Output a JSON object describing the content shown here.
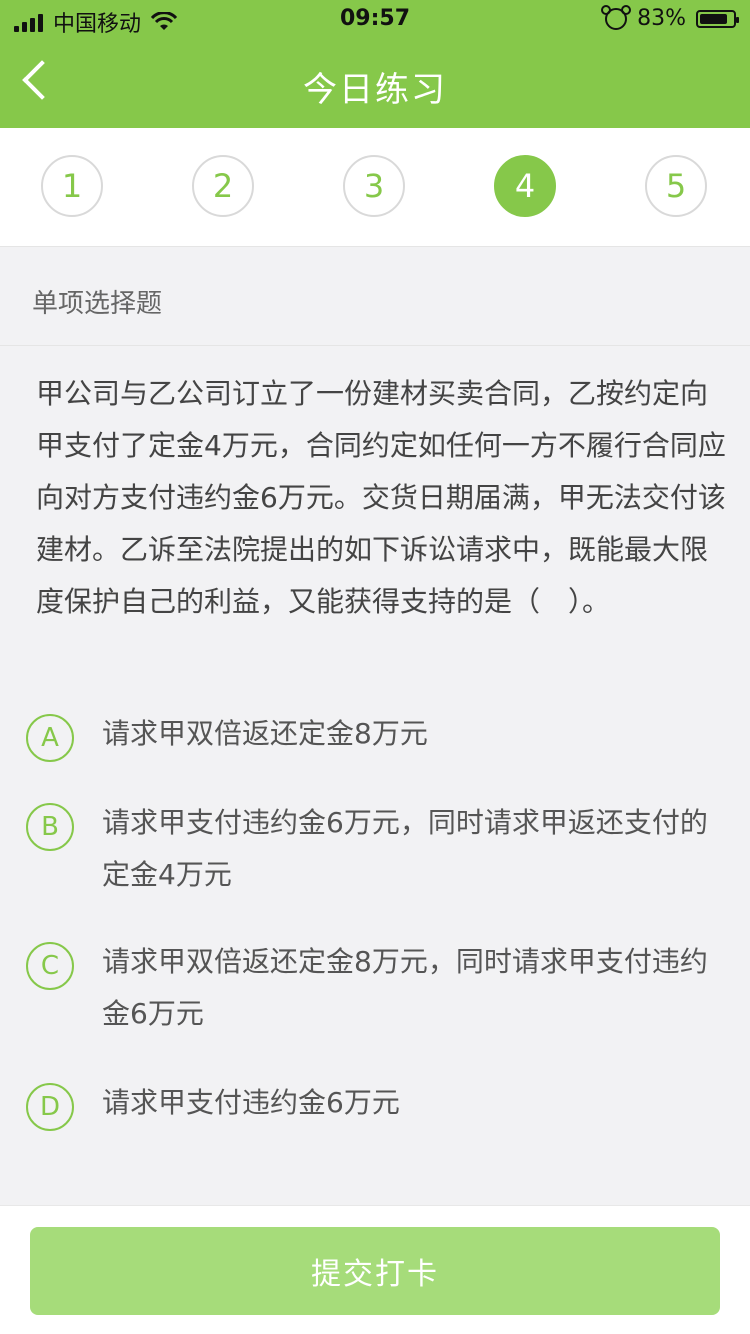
{
  "status_bar": {
    "carrier": "中国移动",
    "time": "09:57",
    "battery": "83%",
    "battery_level": 0.83
  },
  "nav": {
    "title": "今日练习",
    "back_icon": "chevron-left-icon"
  },
  "steps": {
    "items": [
      "1",
      "2",
      "3",
      "4",
      "5"
    ],
    "active_index": 3
  },
  "question": {
    "type_label": "单项选择题",
    "text": "甲公司与乙公司订立了一份建材买卖合同，乙按约定向甲支付了定金4万元，合同约定如任何一方不履行合同应向对方支付违约金6万元。交货日期届满，甲无法交付该建材。乙诉至法院提出的如下诉讼请求中，既能最大限度保护自己的利益，又能获得支持的是（　）。",
    "options": [
      {
        "letter": "A",
        "text": "请求甲双倍返还定金8万元"
      },
      {
        "letter": "B",
        "text": "请求甲支付违约金6万元，同时请求甲返还支付的定金4万元"
      },
      {
        "letter": "C",
        "text": "请求甲双倍返还定金8万元，同时请求甲支付违约金6万元"
      },
      {
        "letter": "D",
        "text": "请求甲支付违约金6万元"
      }
    ]
  },
  "footer": {
    "submit_label": "提交打卡"
  },
  "colors": {
    "accent": "#86c84a",
    "button_disabled": "#a6dc7a"
  }
}
